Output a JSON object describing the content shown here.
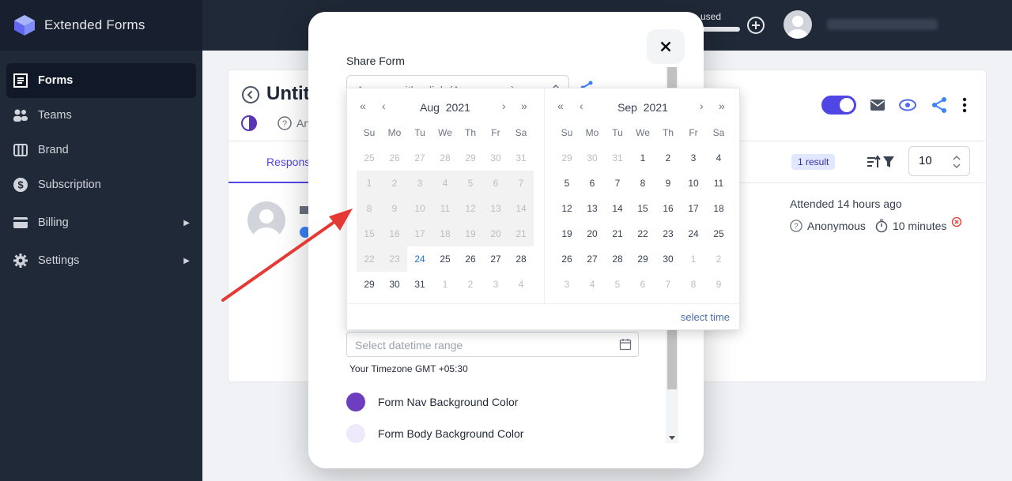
{
  "app": {
    "name": "Extended Forms"
  },
  "sidebar": {
    "items": [
      {
        "label": "Forms",
        "icon": "forms-icon"
      },
      {
        "label": "Teams",
        "icon": "teams-icon"
      },
      {
        "label": "Brand",
        "icon": "brand-icon"
      },
      {
        "label": "Subscription",
        "icon": "subscription-icon"
      },
      {
        "label": "Billing",
        "icon": "billing-icon"
      },
      {
        "label": "Settings",
        "icon": "settings-icon"
      }
    ]
  },
  "topbar": {
    "usage_label": "a used"
  },
  "form_page": {
    "title": "Untit",
    "visibility": "An",
    "tab": "Respons",
    "result_count": "1 result",
    "page_size": "10",
    "response": {
      "attended": "Attended 14 hours ago",
      "user": "Anonymous",
      "duration": "10 minutes"
    }
  },
  "modal": {
    "share_label": "Share Form",
    "share_value": "Anyone with a link (Anonymous)",
    "datetime_placeholder": "Select datetime range",
    "timezone": "Your Timezone GMT +05:30",
    "colors": [
      {
        "label": "Form Nav Background Color",
        "color": "#6d3fc0"
      },
      {
        "label": "Form Body Background Color",
        "color": "#efeafb"
      }
    ]
  },
  "datepicker": {
    "weekdays": [
      "Su",
      "Mo",
      "Tu",
      "We",
      "Th",
      "Fr",
      "Sa"
    ],
    "select_time": "select time",
    "left": {
      "month": "Aug",
      "year": "2021",
      "weeks": [
        [
          "25",
          "26",
          "27",
          "28",
          "29",
          "30",
          "31"
        ],
        [
          "1",
          "2",
          "3",
          "4",
          "5",
          "6",
          "7"
        ],
        [
          "8",
          "9",
          "10",
          "11",
          "12",
          "13",
          "14"
        ],
        [
          "15",
          "16",
          "17",
          "18",
          "19",
          "20",
          "21"
        ],
        [
          "22",
          "23",
          "24",
          "25",
          "26",
          "27",
          "28"
        ],
        [
          "29",
          "30",
          "31",
          "1",
          "2",
          "3",
          "4"
        ]
      ]
    },
    "right": {
      "month": "Sep",
      "year": "2021",
      "weeks": [
        [
          "29",
          "30",
          "31",
          "1",
          "2",
          "3",
          "4"
        ],
        [
          "5",
          "6",
          "7",
          "8",
          "9",
          "10",
          "11"
        ],
        [
          "12",
          "13",
          "14",
          "15",
          "16",
          "17",
          "18"
        ],
        [
          "19",
          "20",
          "21",
          "22",
          "23",
          "24",
          "25"
        ],
        [
          "26",
          "27",
          "28",
          "29",
          "30",
          "1",
          "2"
        ],
        [
          "3",
          "4",
          "5",
          "6",
          "7",
          "8",
          "9"
        ]
      ]
    }
  },
  "colors": {
    "accent": "#4f46e5",
    "sidebar": "#1f2937",
    "arrow": "#e53935"
  }
}
